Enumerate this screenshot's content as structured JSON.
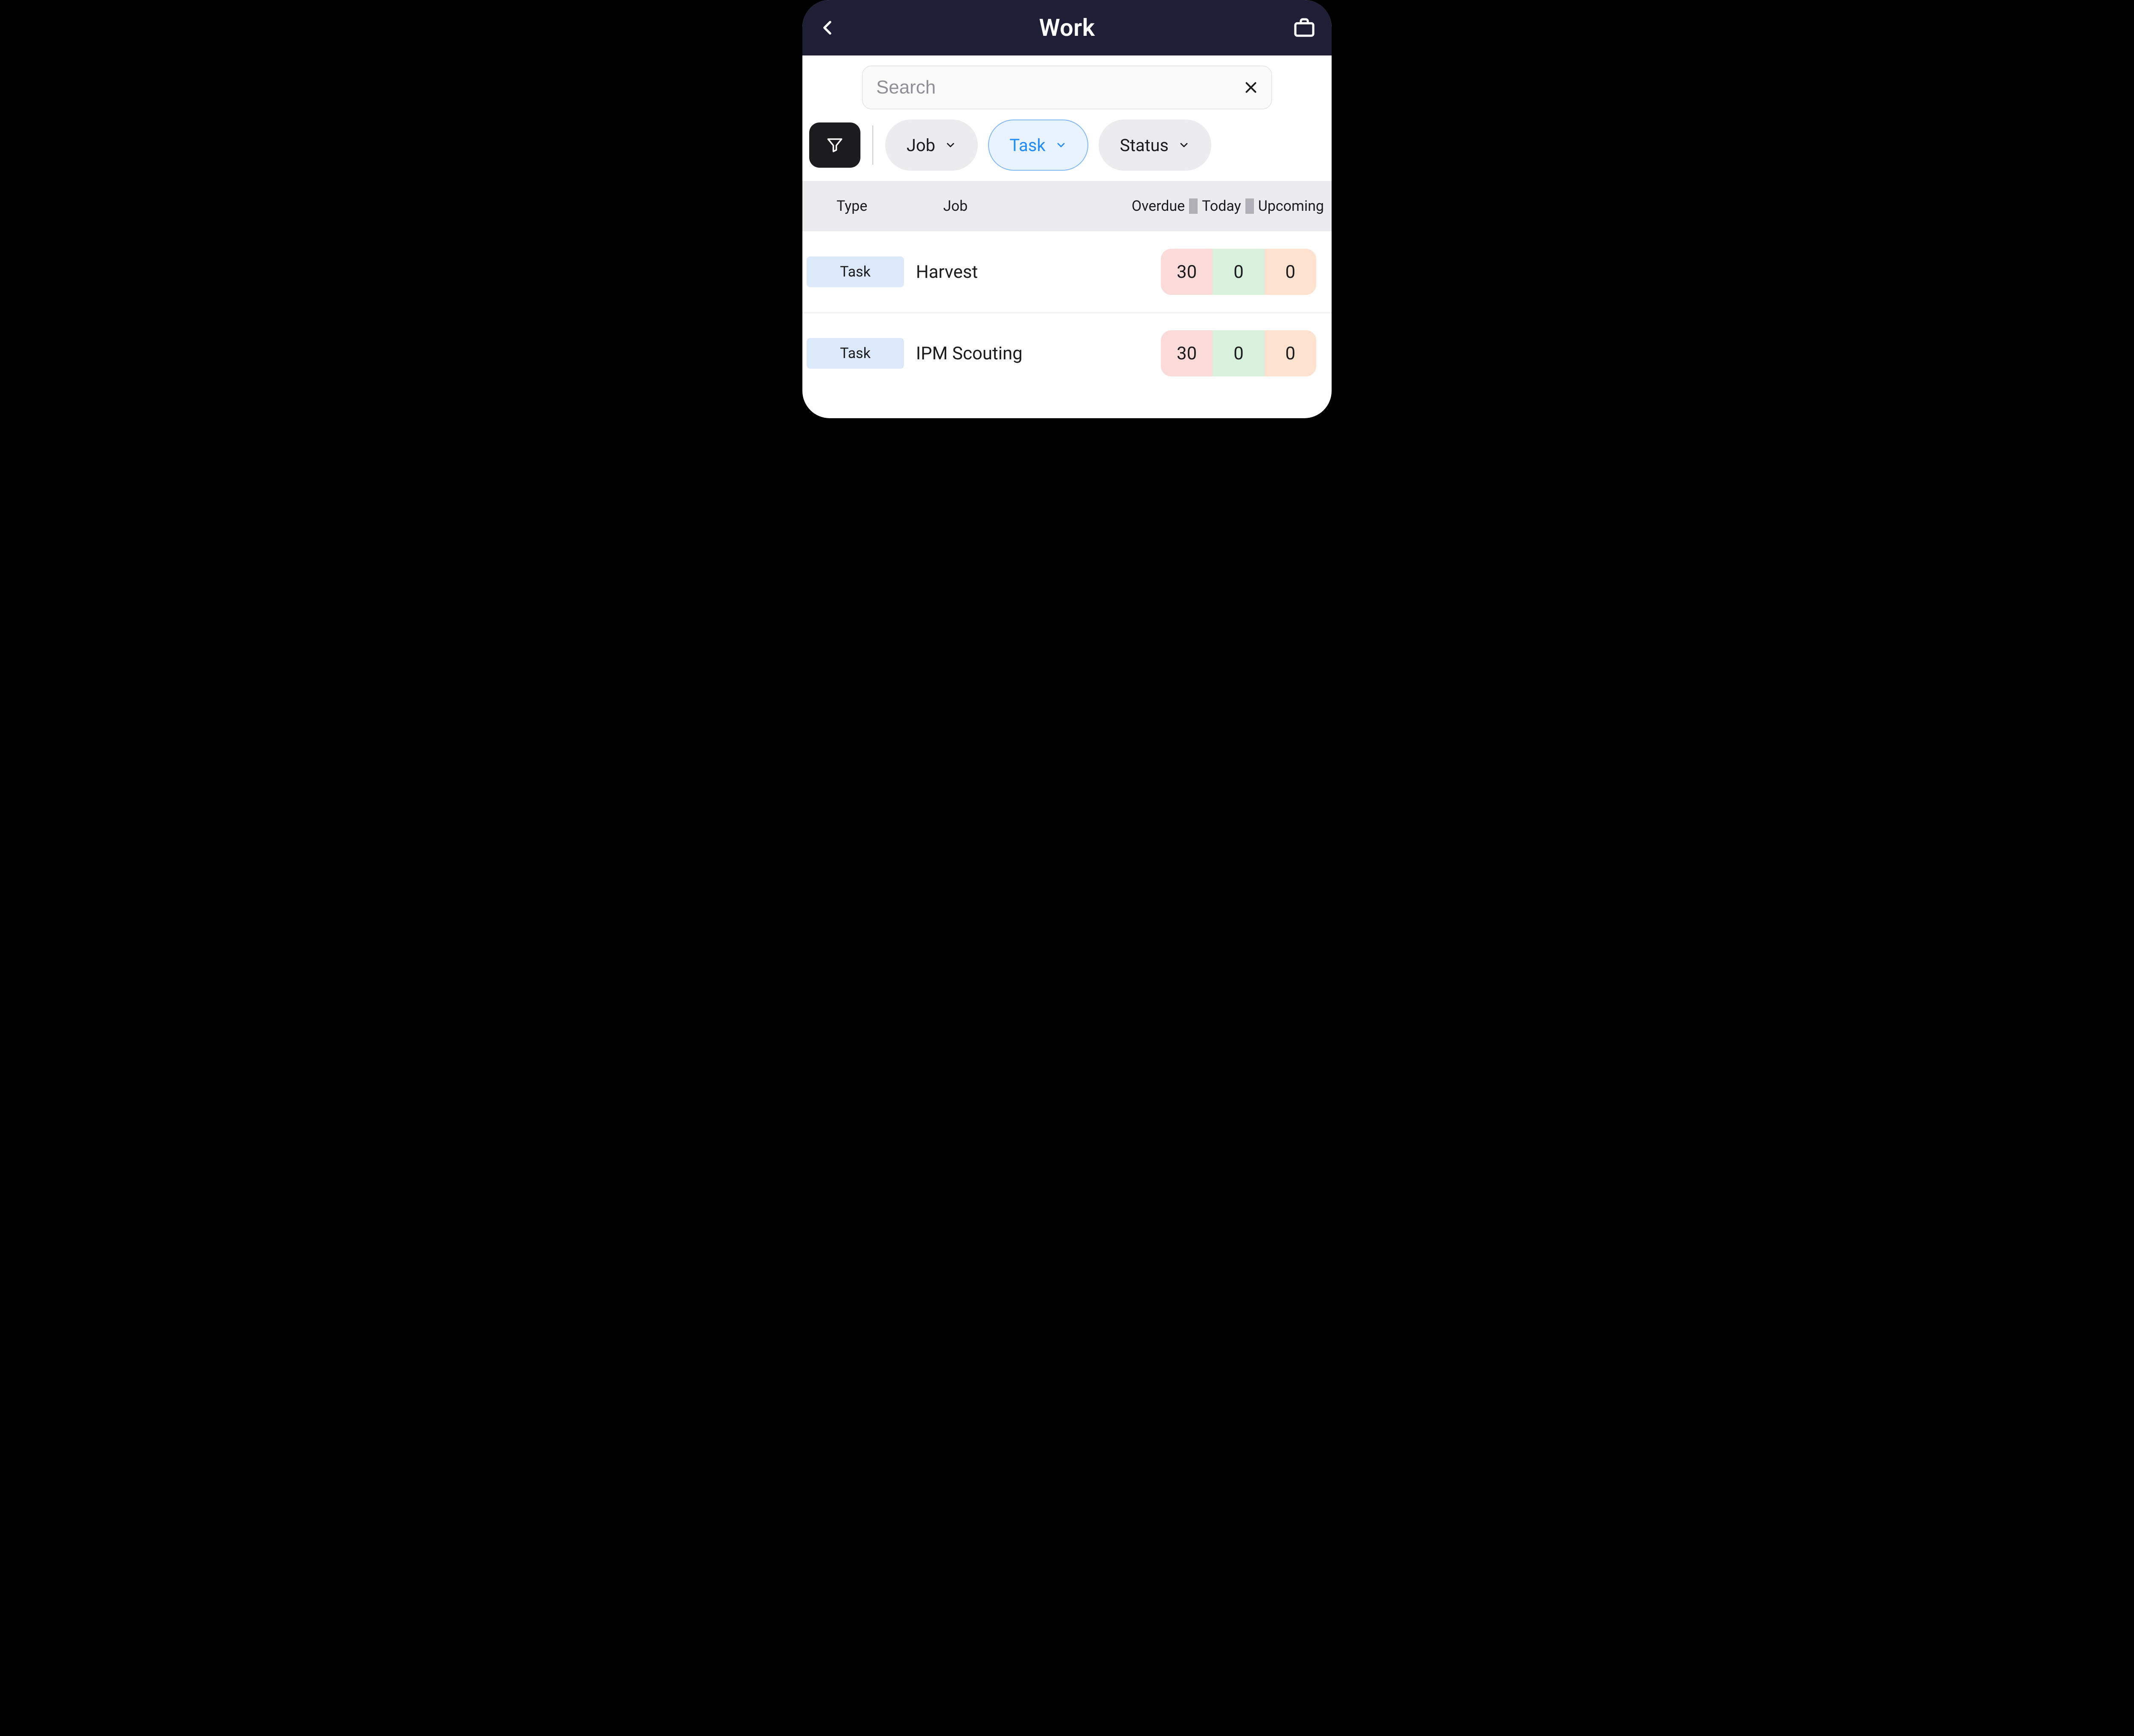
{
  "header": {
    "title": "Work"
  },
  "search": {
    "placeholder": "Search",
    "value": ""
  },
  "filters": {
    "chips": [
      {
        "label": "Job",
        "active": false
      },
      {
        "label": "Task",
        "active": true
      },
      {
        "label": "Status",
        "active": false
      }
    ]
  },
  "table": {
    "headers": {
      "type": "Type",
      "job": "Job",
      "overdue": "Overdue",
      "today": "Today",
      "upcoming": "Upcoming"
    },
    "rows": [
      {
        "type": "Task",
        "job": "Harvest",
        "overdue": 30,
        "today": 0,
        "upcoming": 0
      },
      {
        "type": "Task",
        "job": "IPM Scouting",
        "overdue": 30,
        "today": 0,
        "upcoming": 0
      }
    ]
  }
}
